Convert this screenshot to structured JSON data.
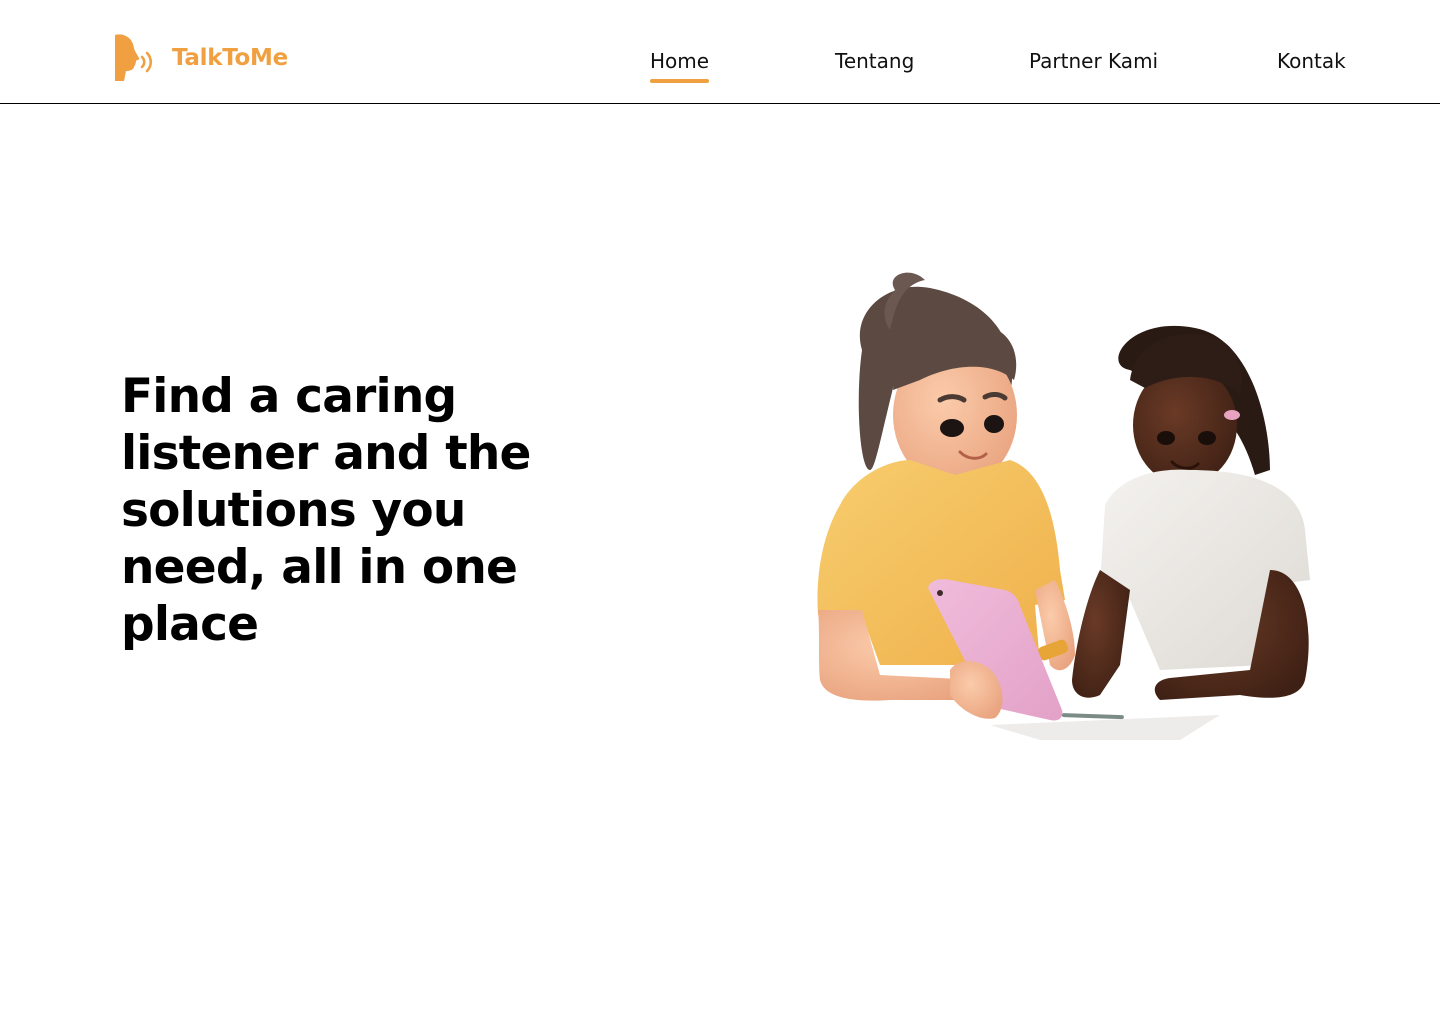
{
  "brand": {
    "name": "TalkToMe",
    "icon": "speaking-head-icon",
    "color": "#F0A041"
  },
  "nav": {
    "items": [
      {
        "label": "Home",
        "active": true
      },
      {
        "label": "Tentang",
        "active": false
      },
      {
        "label": "Partner Kami",
        "active": false
      },
      {
        "label": "Kontak",
        "active": false
      }
    ],
    "active_indicator_color": "#F0A041"
  },
  "hero": {
    "title": "Find a caring listener and the solutions you need, all in one place",
    "illustration": "two-people-using-tablet-illustration"
  }
}
